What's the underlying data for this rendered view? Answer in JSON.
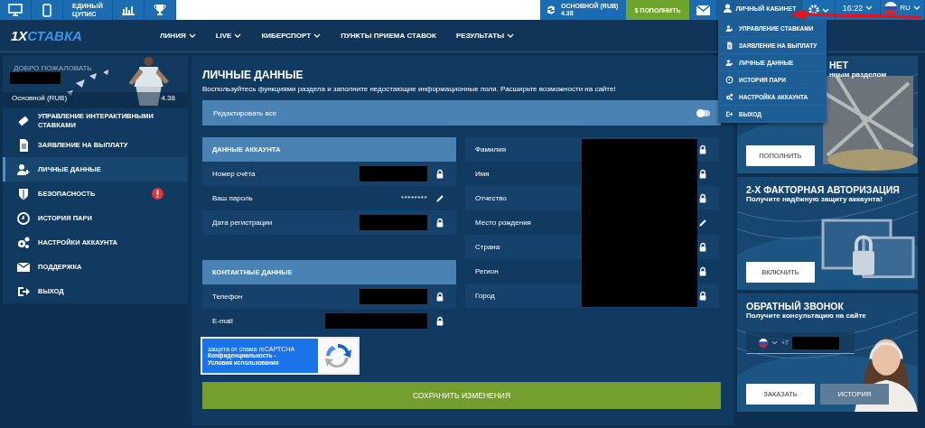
{
  "top_bar": {
    "cupis": [
      "ЕДИНЫЙ",
      "ЦУПИС"
    ],
    "balance": {
      "label": "ОСНОВНОЙ (RUB)",
      "amount": "4.38"
    },
    "deposit": {
      "icon": "$",
      "label": "ПОПОЛНИТЬ"
    },
    "account_button": "ЛИЧНЫЙ КАБИНЕТ",
    "time": "16:22",
    "language": "RU"
  },
  "account_menu": {
    "expanded": true,
    "items": [
      {
        "label": "УПРАВЛЕНИЕ СТАВКАМИ"
      },
      {
        "label": "ЗАЯВЛЕНИЕ НА ВЫПЛАТУ"
      },
      {
        "label": "ЛИЧНЫЕ ДАННЫЕ"
      },
      {
        "label": "ИСТОРИЯ ПАРИ"
      },
      {
        "label": "НАСТРОЙКА АККАУНТА"
      },
      {
        "label": "ВЫХОД"
      }
    ]
  },
  "logo": {
    "prefix": "1X",
    "name": "СТАВКА"
  },
  "nav": [
    {
      "label": "ЛИНИЯ",
      "dropdown": true
    },
    {
      "label": "LIVE",
      "dropdown": true
    },
    {
      "label": "КИБЕРСПОРТ",
      "dropdown": true
    },
    {
      "label": "ПУНКТЫ ПРИЕМА СТАВОК",
      "dropdown": false
    },
    {
      "label": "РЕЗУЛЬТАТЫ",
      "dropdown": true
    }
  ],
  "sidebar": {
    "welcome": "ДОБРО ПОЖАЛОВАТЬ",
    "account": "Основной (RUB)",
    "balance": "4.38",
    "items": [
      {
        "label": "УПРАВЛЕНИЕ ИНТЕРАКТИВНЫМИ СТАВКАМИ",
        "selected": false,
        "alert": false
      },
      {
        "label": "ЗАЯВЛЕНИЕ НА ВЫПЛАТУ",
        "selected": false,
        "alert": false
      },
      {
        "label": "ЛИЧНЫЕ ДАННЫЕ",
        "selected": true,
        "alert": false
      },
      {
        "label": "БЕЗОПАСНОСТЬ",
        "selected": false,
        "alert": true
      },
      {
        "label": "ИСТОРИЯ ПАРИ",
        "selected": false,
        "alert": false
      },
      {
        "label": "НАСТРОЙКИ АККАУНТА",
        "selected": false,
        "alert": false
      },
      {
        "label": "ПОДДЕРЖКА",
        "selected": false,
        "alert": false
      },
      {
        "label": "ВЫХОД",
        "selected": false,
        "alert": false
      }
    ]
  },
  "page": {
    "title": "ЛИЧНЫЕ ДАННЫЕ",
    "subtitle": "Воспользуйтесь функциями раздела и заполните недостающие информационные поля. Расширьте возможности на сайте!",
    "edit_all": {
      "label": "Редактировать все",
      "on": false
    },
    "account_section": {
      "title": "ДАННЫЕ АККАУНТА",
      "rows": [
        {
          "label": "Номер счёта",
          "kind": "lock"
        },
        {
          "label": "Ваш пароль",
          "value": "********",
          "kind": "edit"
        },
        {
          "label": "Дата регистрации",
          "kind": "lock"
        }
      ]
    },
    "contact_section": {
      "title": "КОНТАКТНЫЕ ДАННЫЕ",
      "rows": [
        {
          "label": "Телефон",
          "kind": "lock"
        },
        {
          "label": "E-mail",
          "kind": "lock"
        }
      ]
    },
    "personal_rows": [
      {
        "label": "Фамилия",
        "kind": "lock"
      },
      {
        "label": "Имя",
        "kind": "lock"
      },
      {
        "label": "Отчество",
        "kind": "lock"
      },
      {
        "label": "Место рождения",
        "kind": "edit"
      },
      {
        "label": "Страна",
        "kind": "lock"
      },
      {
        "label": "Регион",
        "kind": "lock"
      },
      {
        "label": "Город",
        "kind": "lock"
      }
    ],
    "recaptcha": {
      "title": "защита от спама reCAPTCHA",
      "links": [
        "Конфиденциальность",
        "Условия использования"
      ],
      "separator": "-"
    },
    "save_button": "СОХРАНИТЬ ИЗМЕНЕНИЯ"
  },
  "banners": [
    {
      "title": "НЕТ",
      "subtitle": "нным разделом",
      "buttons": [
        "ПОПОЛНИТЬ"
      ]
    },
    {
      "title": "2-Х ФАКТОРНАЯ АВТОРИЗАЦИЯ",
      "subtitle": "Получите надёжную защиту аккаунта!",
      "buttons": [
        "ВКЛЮЧИТЬ"
      ]
    },
    {
      "title": "ОБРАТНЫЙ ЗВОНОК",
      "subtitle": "Получите консультацию на сайте",
      "phone_prefix": "+7",
      "buttons": [
        "ЗАКАЗАТЬ",
        "ИСТОРИЯ"
      ]
    }
  ]
}
